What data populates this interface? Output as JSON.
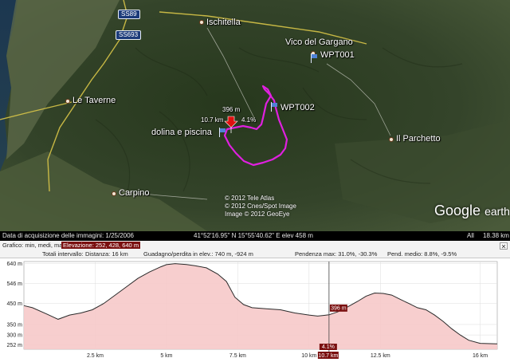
{
  "map": {
    "places": [
      {
        "id": "ischitella",
        "label": "Ischitella"
      },
      {
        "id": "vico",
        "label": "Vico del Gargano"
      },
      {
        "id": "taverne",
        "label": "Le Taverne"
      },
      {
        "id": "parchetto",
        "label": "Il Parchetto"
      },
      {
        "id": "carpino",
        "label": "Carpino"
      }
    ],
    "waypoints": {
      "wpt001": "WPT001",
      "wpt002": "WPT002",
      "dolina": "dolina e piscina"
    },
    "track_labels": {
      "elev": "396 m",
      "dist": "10.7 km",
      "grade": "4.1%"
    },
    "roads": {
      "ss89": "SS89",
      "ss693": "SS693"
    },
    "copyright": {
      "line1": "© 2012 Tele Atlas",
      "line2": "© 2012 Cnes/Spot Image",
      "line3": "Image © 2012 GeoEye"
    },
    "logo_main": "Google",
    "logo_suffix": "earth",
    "track_color": "#e020e0"
  },
  "statusbar": {
    "acquisition": "Data di acquisizione delle immagini: 1/25/2006",
    "coords": "41°52'16.95\" N   15°55'40.62\" E  elev   458 m",
    "all_label": "All",
    "total": "18.38 km"
  },
  "profile_header": {
    "graph_label": "Grafico: min, medi, max",
    "elevation": "Elevazione: 252, 428, 640 m",
    "totals_label": "Totali intervallo:",
    "distance": "Distanza: 16 km",
    "gain_loss": "Guadagno/perdita in elev.: 740 m, -924 m",
    "slope_max": "Pendenza max: 31.0%, -30.3%",
    "slope_avg": "Pend. medio: 8.8%, -9.5%"
  },
  "chart_data": {
    "type": "area",
    "title": "",
    "xlabel": "",
    "ylabel": "",
    "x_ticks": [
      "2.5 km",
      "5 km",
      "7.5 km",
      "10 km",
      "12.5 km",
      "16 km"
    ],
    "x_tick_values": [
      2.5,
      5,
      7.5,
      10,
      12.5,
      16
    ],
    "y_ticks": [
      "640 m",
      "546 m",
      "450 m",
      "350 m",
      "300 m",
      "252 m"
    ],
    "y_tick_values": [
      640,
      546,
      450,
      350,
      300,
      252
    ],
    "xlim": [
      0,
      16.6
    ],
    "ylim": [
      232,
      650
    ],
    "series": [
      {
        "x": [
          0,
          0.3,
          0.8,
          1.2,
          1.6,
          2.0,
          2.4,
          2.8,
          3.2,
          3.6,
          4.0,
          4.4,
          4.8,
          5.0,
          5.3,
          5.7,
          6.0,
          6.4,
          6.8,
          7.1,
          7.4,
          7.7,
          8.0,
          8.5,
          9.0,
          9.5,
          10.0,
          10.3,
          10.5,
          10.7,
          11.0,
          11.3,
          11.7,
          12.0,
          12.3,
          12.6,
          12.9,
          13.2,
          13.5,
          13.8,
          14.1,
          14.4,
          14.7,
          15.0,
          15.3,
          15.6,
          16.0,
          16.6
        ],
        "y": [
          440,
          430,
          400,
          375,
          395,
          405,
          420,
          450,
          490,
          530,
          570,
          600,
          625,
          635,
          640,
          636,
          630,
          620,
          590,
          555,
          480,
          445,
          430,
          425,
          420,
          405,
          395,
          390,
          393,
          396,
          410,
          430,
          460,
          485,
          500,
          498,
          490,
          470,
          450,
          430,
          420,
          395,
          365,
          330,
          300,
          275,
          260,
          258
        ],
        "color": "#c81c1c"
      }
    ],
    "cursor": {
      "x": 10.7,
      "elev_label": "396 m",
      "grade_label": "4.1%",
      "dist_label": "10.7 km"
    }
  }
}
